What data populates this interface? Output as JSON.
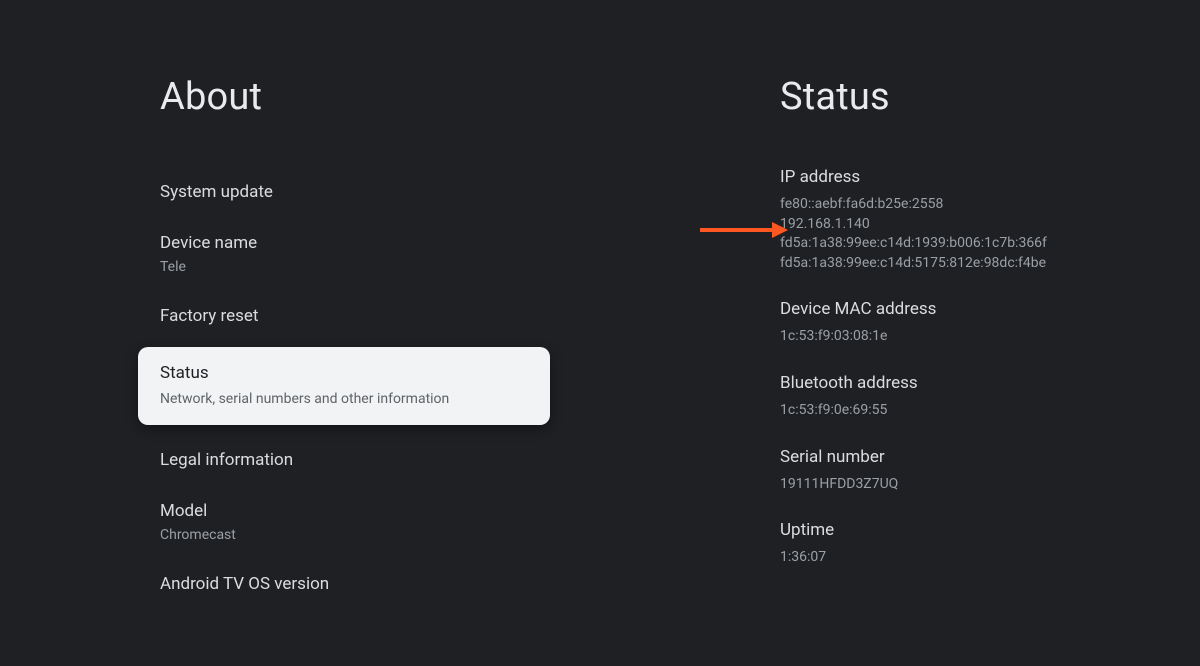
{
  "left": {
    "title": "About",
    "items": [
      {
        "label": "System update",
        "subtitle": null
      },
      {
        "label": "Device name",
        "subtitle": "Tele"
      },
      {
        "label": "Factory reset",
        "subtitle": null
      },
      {
        "label": "Status",
        "subtitle": "Network, serial numbers and other information",
        "selected": true
      },
      {
        "label": "Legal information",
        "subtitle": null
      },
      {
        "label": "Model",
        "subtitle": "Chromecast"
      },
      {
        "label": "Android TV OS version",
        "subtitle": null
      }
    ]
  },
  "right": {
    "title": "Status",
    "sections": [
      {
        "label": "IP address",
        "values": [
          "fe80::aebf:fa6d:b25e:2558",
          "192.168.1.140",
          "fd5a:1a38:99ee:c14d:1939:b006:1c7b:366f",
          "fd5a:1a38:99ee:c14d:5175:812e:98dc:f4be"
        ]
      },
      {
        "label": "Device MAC address",
        "values": [
          "1c:53:f9:03:08:1e"
        ]
      },
      {
        "label": "Bluetooth address",
        "values": [
          "1c:53:f9:0e:69:55"
        ]
      },
      {
        "label": "Serial number",
        "values": [
          "19111HFDD3Z7UQ"
        ]
      },
      {
        "label": "Uptime",
        "values": [
          "1:36:07"
        ]
      }
    ]
  },
  "annotation": {
    "arrow_color": "#ff5722"
  }
}
